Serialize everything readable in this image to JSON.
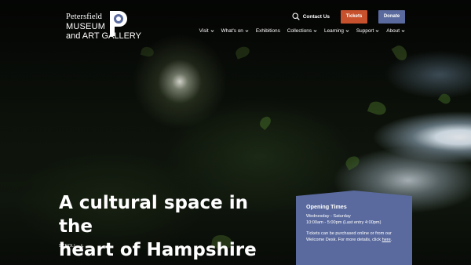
{
  "logo": {
    "line1": "Petersfield",
    "line2": "MUSEUM",
    "line3": "and ART GALLERY",
    "mark": "P"
  },
  "header": {
    "contact_label": "Contact Us",
    "tickets_label": "Tickets",
    "donate_label": "Donate"
  },
  "nav": {
    "items": [
      {
        "label": "Visit",
        "has_dropdown": true
      },
      {
        "label": "What's on",
        "has_dropdown": true
      },
      {
        "label": "Exhibitions",
        "has_dropdown": false
      },
      {
        "label": "Collections",
        "has_dropdown": true
      },
      {
        "label": "Learning",
        "has_dropdown": true
      },
      {
        "label": "Support",
        "has_dropdown": true
      },
      {
        "label": "About",
        "has_dropdown": true
      }
    ]
  },
  "hero": {
    "headline_line1": "A cultural space in the",
    "headline_line2": "heart of Hampshire",
    "scroll_label": "SCROLL"
  },
  "opening_times": {
    "title": "Opening Times",
    "days": "Wednesday - Saturday",
    "hours": "10:00am - 5:00pm (Last entry 4:00pm)",
    "note_line1": "Tickets can be purchased online or from our",
    "note_line2": "Welcome Desk. For more details, click",
    "link_label": "here",
    "link_suffix": "."
  },
  "colors": {
    "tickets": "#c8512d",
    "donate": "#5a6a9e",
    "panel": "#5a6a9e"
  }
}
